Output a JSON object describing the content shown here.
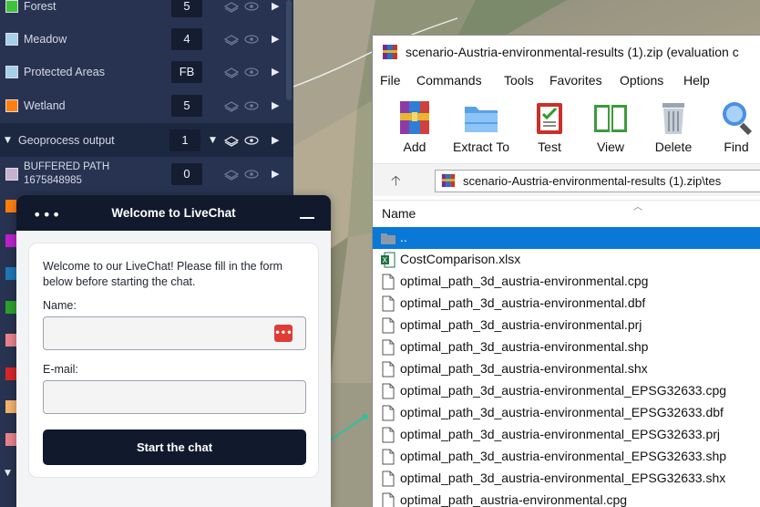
{
  "layers": [
    {
      "name": "Forest",
      "count": "5",
      "color": "#3ec43a"
    },
    {
      "name": "Meadow",
      "count": "4",
      "color": "#a8cfe8"
    },
    {
      "name": "Protected Areas",
      "count": "FB",
      "color": "#a8cfe8"
    },
    {
      "name": "Wetland",
      "count": "5",
      "color": "#ff7f0e"
    }
  ],
  "geoprocess": {
    "label": "Geoprocess output",
    "count": "1"
  },
  "buffered": {
    "name_line1": "BUFFERED PATH",
    "name_line2": "1675848985",
    "count": "0",
    "color": "#c8b0cf"
  },
  "partial_swatches": [
    "#ff7f0e",
    "#bb22cc",
    "#1f77b4",
    "#2ca02c",
    "#e8828d",
    "#d62728",
    "#f5b26b",
    "#e8828d"
  ],
  "livechat": {
    "title": "Welcome to LiveChat",
    "intro": "Welcome to our LiveChat! Please fill in the form below before starting the chat.",
    "name_label": "Name:",
    "email_label": "E-mail:",
    "start_button": "Start the chat",
    "password_icon_text": "•••"
  },
  "winrar": {
    "title": "scenario-Austria-environmental-results (1).zip (evaluation c",
    "menu": [
      "File",
      "Commands",
      "Tools",
      "Favorites",
      "Options",
      "Help"
    ],
    "toolbar": [
      "Add",
      "Extract To",
      "Test",
      "View",
      "Delete",
      "Find"
    ],
    "path": "scenario-Austria-environmental-results (1).zip\\tes",
    "column_name": "Name",
    "files": [
      {
        "name": "..",
        "type": "folder"
      },
      {
        "name": "CostComparison.xlsx",
        "type": "excel"
      },
      {
        "name": "optimal_path_3d_austria-environmental.cpg",
        "type": "file"
      },
      {
        "name": "optimal_path_3d_austria-environmental.dbf",
        "type": "file"
      },
      {
        "name": "optimal_path_3d_austria-environmental.prj",
        "type": "file"
      },
      {
        "name": "optimal_path_3d_austria-environmental.shp",
        "type": "file"
      },
      {
        "name": "optimal_path_3d_austria-environmental.shx",
        "type": "file"
      },
      {
        "name": "optimal_path_3d_austria-environmental_EPSG32633.cpg",
        "type": "file"
      },
      {
        "name": "optimal_path_3d_austria-environmental_EPSG32633.dbf",
        "type": "file"
      },
      {
        "name": "optimal_path_3d_austria-environmental_EPSG32633.prj",
        "type": "file"
      },
      {
        "name": "optimal_path_3d_austria-environmental_EPSG32633.shp",
        "type": "file"
      },
      {
        "name": "optimal_path_3d_austria-environmental_EPSG32633.shx",
        "type": "file"
      },
      {
        "name": "optimal_path_austria-environmental.cpg",
        "type": "file"
      }
    ],
    "selected_index": 0
  }
}
